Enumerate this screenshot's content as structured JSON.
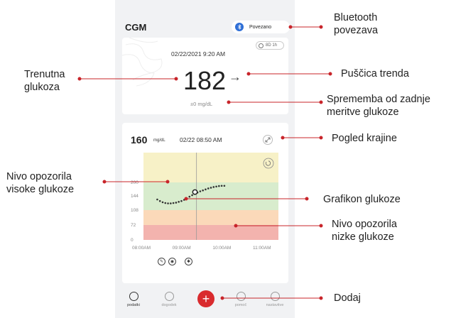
{
  "app": {
    "title": "CGM"
  },
  "bluetooth": {
    "label": "Povezano",
    "icon": "bluetooth-icon"
  },
  "current": {
    "sensor_time": "8D 1h",
    "datetime": "02/22/2021 9:20 AM",
    "value": "182",
    "trend_arrow": "→",
    "delta": "±0 mg/dL"
  },
  "history": {
    "value": "160",
    "unit": "mg/dL",
    "datetime": "02/22 08:50 AM"
  },
  "chart_data": {
    "type": "line",
    "x_ticks": [
      "08:00AM",
      "09:00AM",
      "10:00AM",
      "11:00AM"
    ],
    "y_ticks": [
      "200",
      "144",
      "108",
      "72",
      "0"
    ],
    "bands": [
      {
        "name": "high",
        "from": 200,
        "to": 250,
        "color": "#f7f1c7"
      },
      {
        "name": "target",
        "from": 108,
        "to": 200,
        "color": "#d8eccd"
      },
      {
        "name": "low",
        "from": 72,
        "to": 108,
        "color": "#fbd9b9"
      },
      {
        "name": "urgent-low",
        "from": 0,
        "to": 72,
        "color": "#f3b3ae"
      }
    ],
    "series": [
      {
        "x": [
          "08:10",
          "08:14",
          "08:18",
          "08:22",
          "08:26",
          "08:30",
          "08:34",
          "08:38",
          "08:42",
          "08:46",
          "08:50",
          "08:54",
          "08:58",
          "09:02",
          "09:06",
          "09:10",
          "09:14",
          "09:18",
          "09:22",
          "09:26",
          "09:30",
          "09:34",
          "09:38",
          "09:42",
          "09:46",
          "09:50"
        ],
        "y": [
          135,
          131,
          128,
          126,
          125,
          125,
          126,
          127,
          129,
          131,
          134,
          138,
          142,
          147,
          152,
          158,
          163,
          167,
          171,
          175,
          178,
          181,
          183,
          185,
          186,
          186
        ]
      }
    ],
    "selected_point": {
      "x": "09:03",
      "y": 160
    },
    "cursor_x": "09:00"
  },
  "nav": {
    "items": [
      {
        "label": "podatki",
        "active": true
      },
      {
        "label": "dogodek"
      },
      {
        "label": "pomoč"
      },
      {
        "label": "nastavitve"
      }
    ],
    "add_label": "+"
  },
  "annotations": {
    "bluetooth": [
      "Bluetooth",
      "povezava"
    ],
    "current_glucose": [
      "Trenutna",
      "glukoza"
    ],
    "trend_arrow": [
      "Puščica trenda"
    ],
    "change": [
      "Sprememba od zadnje",
      "meritve glukoze"
    ],
    "landscape": [
      "Pogled krajine"
    ],
    "high_alert": [
      "Nivo opozorila",
      "visoke glukoze"
    ],
    "glucose_chart": [
      "Grafikon glukoze"
    ],
    "low_alert": [
      "Nivo opozorila",
      "nizke glukoze"
    ],
    "add": [
      "Dodaj"
    ]
  },
  "colors": {
    "accent": "#d92b2e",
    "bluetooth": "#2f6fd6",
    "annotation_line": "#c8252a"
  }
}
